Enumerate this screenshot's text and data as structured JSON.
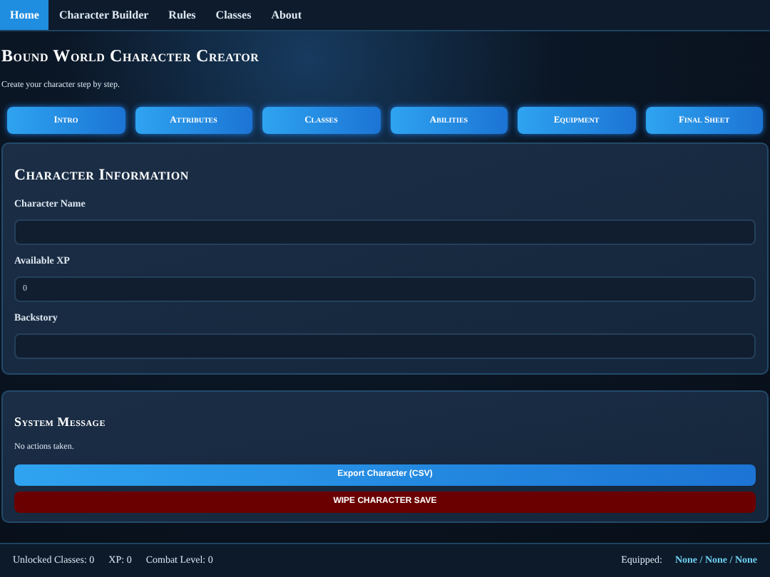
{
  "nav": [
    {
      "label": "Home",
      "selected": true
    },
    {
      "label": "Character Builder",
      "selected": false
    },
    {
      "label": "Rules",
      "selected": false
    },
    {
      "label": "Classes",
      "selected": false
    },
    {
      "label": "About",
      "selected": false
    }
  ],
  "header": {
    "title": "Bound World Character Creator",
    "subtitle": "Create your character step by step."
  },
  "steps": [
    "Intro",
    "Attributes",
    "Classes",
    "Abilities",
    "Equipment",
    "Final Sheet"
  ],
  "character_information": {
    "title": "Character Information",
    "fields": [
      {
        "label": "Character Name"
      },
      {
        "label": "Available XP",
        "value": "0"
      },
      {
        "label": "Backstory"
      }
    ]
  },
  "system_message": {
    "title": "System Message",
    "message": "No actions taken.",
    "buttons": [
      {
        "label": "Export Character (CSV)",
        "kind": "primary"
      },
      {
        "label": "WIPE CHARACTER SAVE",
        "kind": "danger"
      }
    ]
  },
  "status_bar": {
    "stats": [
      "Unlocked Classes: 0",
      "XP: 0",
      "Combat Level: 0"
    ],
    "equipped_label": "Equipped:",
    "equipped_value": "None / None / None"
  }
}
